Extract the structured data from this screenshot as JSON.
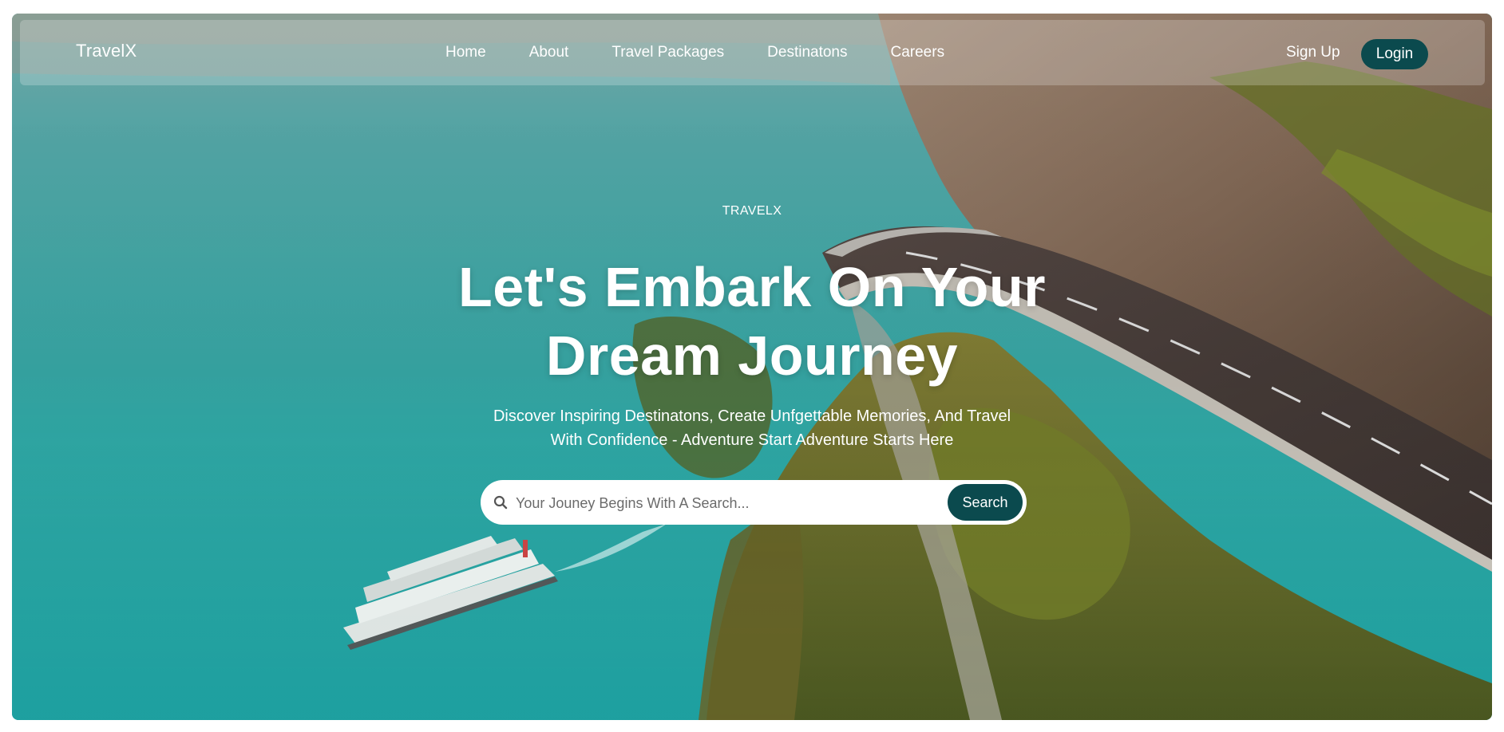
{
  "brand": "TravelX",
  "nav": {
    "links": [
      "Home",
      "About",
      "Travel Packages",
      "Destinatons",
      "Careers"
    ],
    "sign_up": "Sign Up",
    "login": "Login"
  },
  "hero": {
    "eyebrow": "TRAVELX",
    "headline_line1": "Let's Embark On Your",
    "headline_line2": "Dream Journey",
    "subline_line1": "Discover Inspiring Destinatons, Create Unfgettable Memories, And Travel",
    "subline_line2": "With Confidence - Adventure Start Adventure Starts Here"
  },
  "search": {
    "placeholder": "Your Jouney Begins With A Search...",
    "button": "Search",
    "icon": "search-icon"
  },
  "colors": {
    "accent": "#0b4a4e",
    "water": "#34b5b3",
    "text_on_hero": "#ffffff"
  }
}
